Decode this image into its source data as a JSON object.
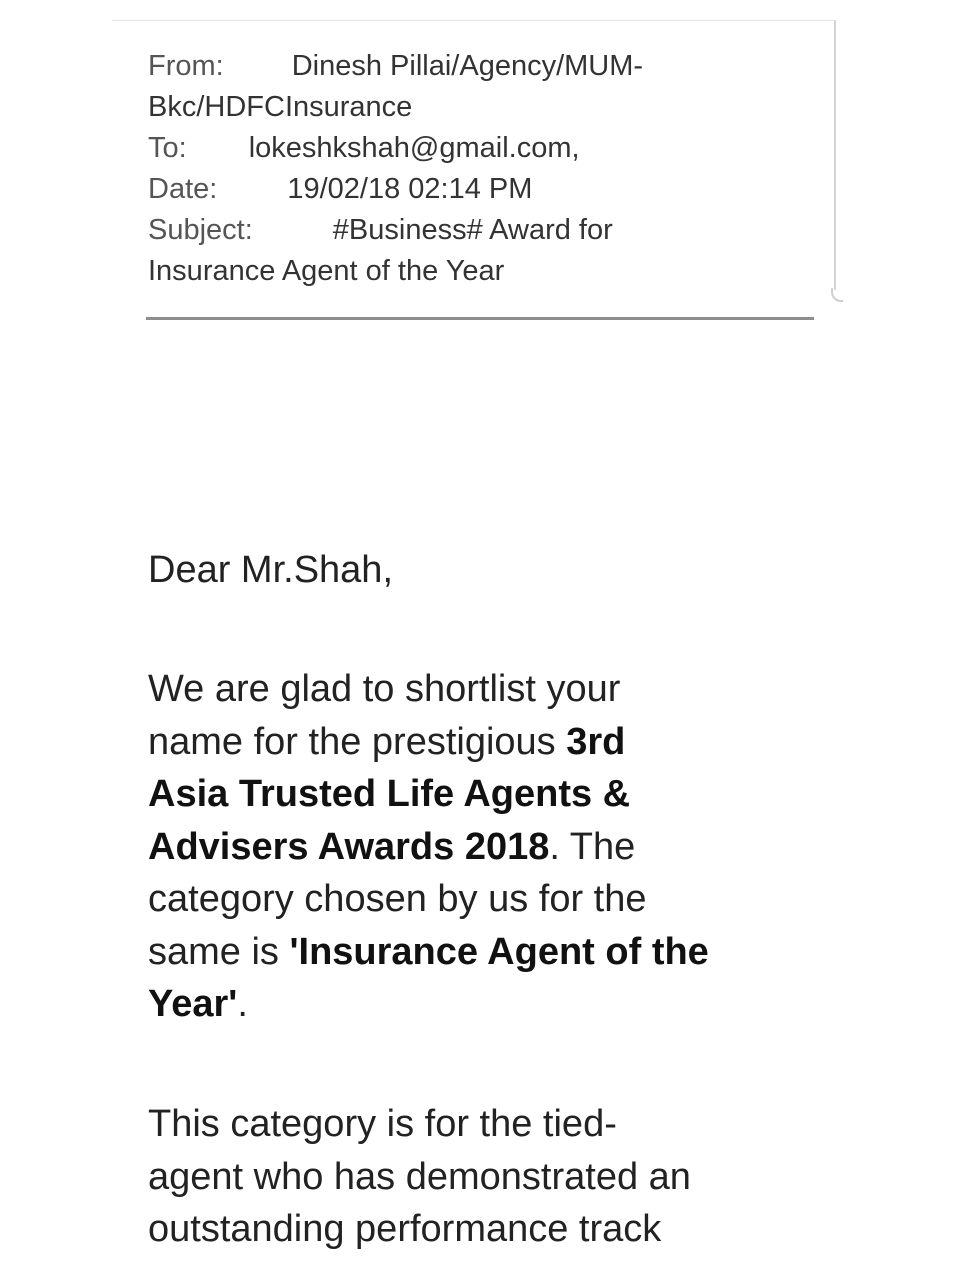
{
  "email": {
    "from_label": "From:",
    "from_value_line1": "Dinesh Pillai/Agency/MUM-",
    "from_value_line2": "Bkc/HDFCInsurance",
    "to_label": "To:",
    "to_value": "lokeshkshah@gmail.com,",
    "date_label": "Date:",
    "date_value": "19/02/18 02:14 PM",
    "subject_label": "Subject:",
    "subject_value_line1": "#Business# Award for",
    "subject_value_line2": "Insurance Agent of the Year"
  },
  "body": {
    "greeting": "Dear Mr.Shah,",
    "para1": {
      "l1": "We are glad to shortlist your",
      "l2_plain": "name for the prestigious ",
      "l2_bold": "3rd",
      "l3_bold": "Asia Trusted Life Agents &",
      "l4_bold": "Advisers Awards 2018",
      "l4_plain": ". The",
      "l5": "category chosen by us for the",
      "l6_plain": "same is ",
      "l6_bold": "'Insurance Agent of the",
      "l7_bold": "Year'",
      "l7_plain": "."
    },
    "para2": {
      "l1": "This category is for the tied-",
      "l2": "agent who has demonstrated an",
      "l3": "outstanding performance track"
    }
  }
}
